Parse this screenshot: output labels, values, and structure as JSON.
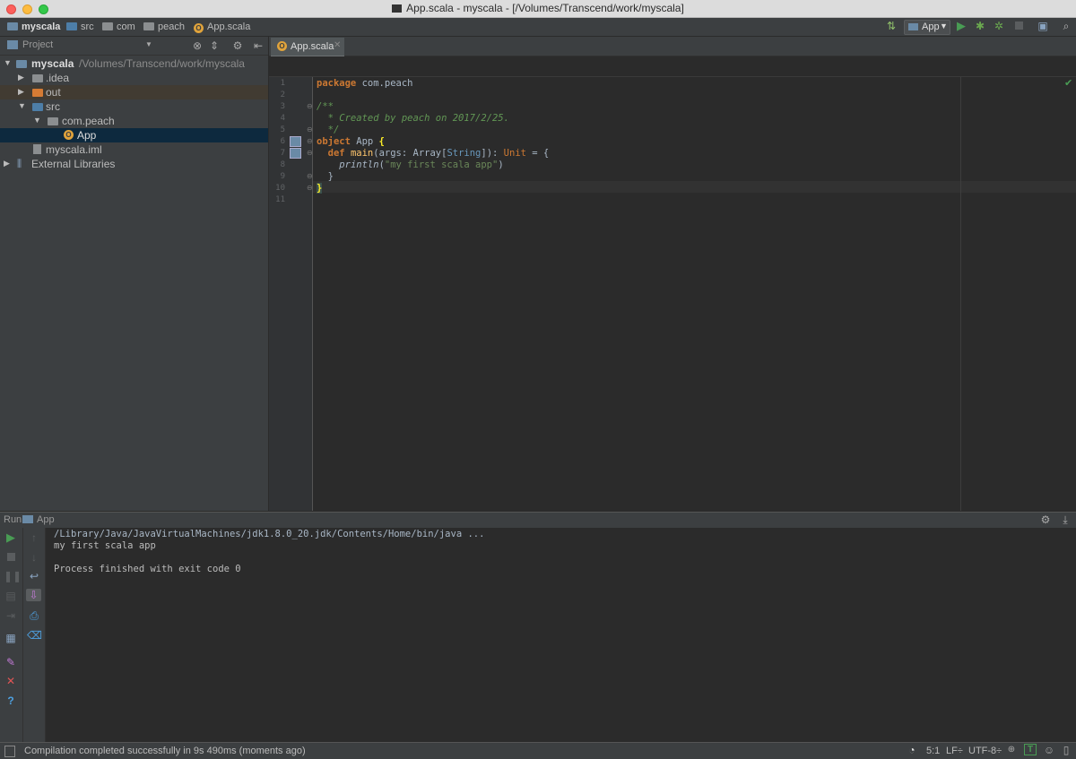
{
  "window": {
    "title": "App.scala - myscala - [/Volumes/Transcend/work/myscala]"
  },
  "breadcrumbs": [
    "myscala",
    "src",
    "com",
    "peach",
    "App.scala"
  ],
  "toolbar": {
    "run_config": "App"
  },
  "project_panel": {
    "title": "Project",
    "tree": [
      {
        "label": "myscala",
        "path": "/Volumes/Transcend/work/myscala",
        "expanded": true
      },
      {
        "label": ".idea"
      },
      {
        "label": "out"
      },
      {
        "label": "src",
        "expanded": true
      },
      {
        "label": "com.peach",
        "expanded": true
      },
      {
        "label": "App",
        "selected": true
      },
      {
        "label": "myscala.iml"
      },
      {
        "label": "External Libraries"
      }
    ]
  },
  "editor": {
    "tab": "App.scala",
    "line_numbers": [
      "1",
      "2",
      "3",
      "4",
      "5",
      "6",
      "7",
      "8",
      "9",
      "10",
      "11"
    ],
    "code": {
      "l1_kw": "package",
      "l1_rest": " com.peach",
      "l3": "/**",
      "l4": "  * Created by peach on 2017/2/25.",
      "l5": "  */",
      "l6_kw": "object",
      "l6_rest": " App ",
      "l6_brace": "{",
      "l7_kw": "def",
      "l7_fn": "main",
      "l7_a": "(args: Array[",
      "l7_t": "String",
      "l7_b": "]): ",
      "l7_unit": "Unit",
      "l7_c": " = {",
      "l8_fn": "println",
      "l8_open": "(",
      "l8_str": "\"my first scala app\"",
      "l8_close": ")",
      "l9": "  }",
      "l10": "}"
    }
  },
  "run_panel": {
    "label": "Run",
    "config": "App",
    "console": [
      "/Library/Java/JavaVirtualMachines/jdk1.8.0_20.jdk/Contents/Home/bin/java ...",
      "my first scala app",
      "Process finished with exit code 0"
    ]
  },
  "statusbar": {
    "message": "Compilation completed successfully in 9s 490ms (moments ago)",
    "position": "5:1",
    "line_sep": "LF÷",
    "encoding": "UTF-8÷"
  },
  "colors": {
    "accent_green": "#499c54",
    "selection": "#0d293e",
    "keyword": "#cc7832",
    "comment": "#629755"
  },
  "icons": [
    "folder-icon",
    "scala-object-icon",
    "run-icon",
    "debug-icon",
    "stop-icon",
    "gear-icon",
    "collapse-icon",
    "close-icon"
  ]
}
